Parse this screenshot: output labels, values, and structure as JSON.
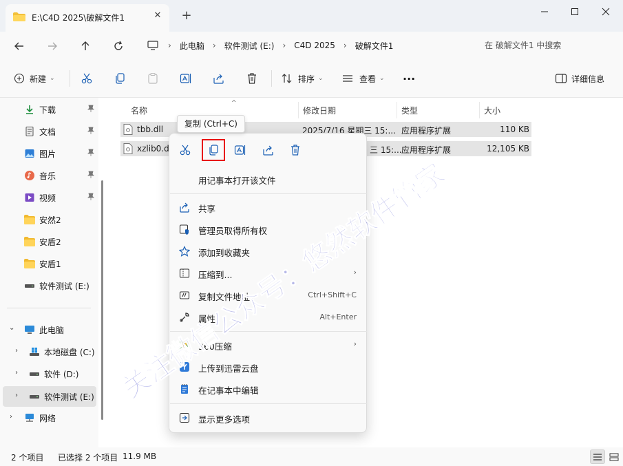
{
  "window": {
    "tab_title": "E:\\C4D 2025\\破解文件1",
    "new_tab": "+"
  },
  "nav": {
    "breadcrumbs": [
      "此电脑",
      "软件测试 (E:)",
      "C4D 2025",
      "破解文件1"
    ],
    "search_placeholder": "在 破解文件1 中搜索"
  },
  "toolbar": {
    "new_label": "新建",
    "sort_label": "排序",
    "view_label": "查看",
    "more_label": "···",
    "details_label": "详细信息"
  },
  "sidebar": {
    "quick": [
      {
        "label": "下载",
        "icon": "download-icon"
      },
      {
        "label": "文档",
        "icon": "document-icon"
      },
      {
        "label": "图片",
        "icon": "picture-icon"
      },
      {
        "label": "音乐",
        "icon": "music-icon"
      },
      {
        "label": "视频",
        "icon": "video-icon"
      },
      {
        "label": "安然2",
        "icon": "folder-icon"
      },
      {
        "label": "安盾2",
        "icon": "folder-icon"
      },
      {
        "label": "安盾1",
        "icon": "folder-icon"
      },
      {
        "label": "软件测试 (E:)",
        "icon": "drive-icon"
      }
    ],
    "tree": [
      {
        "label": "此电脑",
        "icon": "computer-icon"
      },
      {
        "label": "本地磁盘 (C:)",
        "icon": "windows-drive-icon"
      },
      {
        "label": "软件 (D:)",
        "icon": "drive-icon"
      },
      {
        "label": "软件测试 (E:)",
        "icon": "drive-icon"
      },
      {
        "label": "网络",
        "icon": "network-icon"
      }
    ]
  },
  "columns": {
    "name": "名称",
    "modified": "修改日期",
    "type": "类型",
    "size": "大小"
  },
  "files": [
    {
      "name": "tbb.dll",
      "modified": "2025/7/16 星期三 15:...",
      "type": "应用程序扩展",
      "size": "110 KB"
    },
    {
      "name": "xzlib0.dl",
      "modified": "三 15:...",
      "type": "应用程序扩展",
      "size": "12,105 KB"
    }
  ],
  "tooltip": "复制 (Ctrl+C)",
  "context_menu": {
    "quick_actions": [
      "cut-icon",
      "copy-icon",
      "rename-icon",
      "share-icon",
      "delete-icon"
    ],
    "items": [
      {
        "label": "用记事本打开该文件",
        "shortcut": "",
        "submenu": false,
        "icon": ""
      },
      {
        "label": "共享",
        "shortcut": "",
        "submenu": false,
        "icon": "share-icon"
      },
      {
        "label": "管理员取得所有权",
        "shortcut": "",
        "submenu": false,
        "icon": "shield-icon"
      },
      {
        "label": "添加到收藏夹",
        "shortcut": "",
        "submenu": false,
        "icon": "star-icon"
      },
      {
        "label": "压缩到...",
        "shortcut": "",
        "submenu": true,
        "icon": "zip-icon"
      },
      {
        "label": "复制文件地址",
        "shortcut": "Ctrl+Shift+C",
        "submenu": false,
        "icon": "path-icon"
      },
      {
        "label": "属性",
        "shortcut": "Alt+Enter",
        "submenu": false,
        "icon": "wrench-icon"
      },
      {
        "label": "360压缩",
        "shortcut": "",
        "submenu": true,
        "icon": "360zip-icon"
      },
      {
        "label": "上传到迅雷云盘",
        "shortcut": "",
        "submenu": false,
        "icon": "thunder-cloud-icon"
      },
      {
        "label": "在记事本中编辑",
        "shortcut": "",
        "submenu": false,
        "icon": "notepad-icon"
      },
      {
        "label": "显示更多选项",
        "shortcut": "",
        "submenu": false,
        "icon": "more-options-icon"
      }
    ]
  },
  "status": {
    "count": "2 个项目",
    "selected": "已选择 2 个项目",
    "size": "11.9 MB"
  },
  "watermark": "关注微信公众号：悠然软件管家",
  "colors": {
    "accent": "#0a5cc2",
    "highlight_border": "#e81212",
    "selection": "#e4e4e4",
    "watermark": "#3a3fc8"
  }
}
